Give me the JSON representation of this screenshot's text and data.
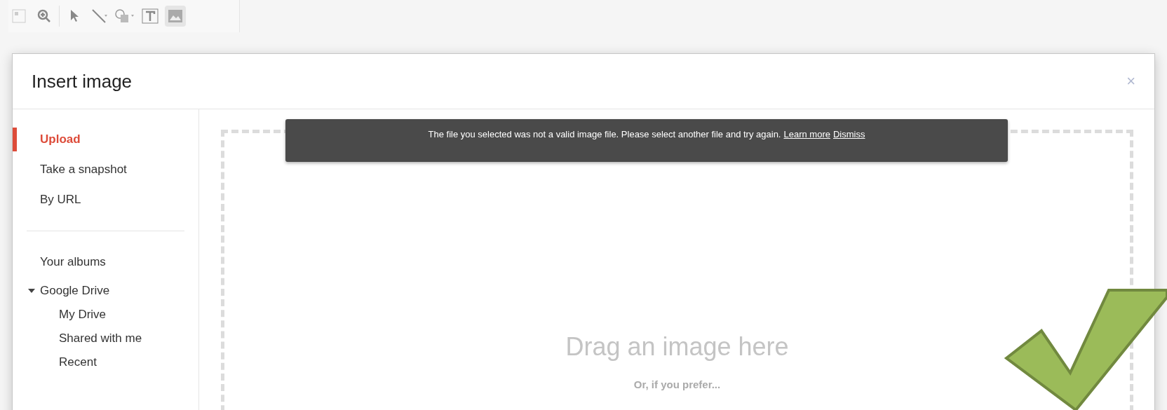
{
  "dialog": {
    "title": "Insert image",
    "close": "×"
  },
  "sidebar": {
    "sources": [
      {
        "label": "Upload",
        "selected": true
      },
      {
        "label": "Take a snapshot",
        "selected": false
      },
      {
        "label": "By URL",
        "selected": false
      }
    ],
    "locations": [
      {
        "label": "Your albums",
        "selected": false
      },
      {
        "label": "Google Drive",
        "selected": false,
        "expanded": true,
        "children": [
          {
            "label": "My Drive",
            "selected": false
          },
          {
            "label": "Shared with me",
            "selected": false
          },
          {
            "label": "Recent",
            "selected": false
          }
        ]
      }
    ]
  },
  "error_banner": {
    "message": "The file you selected was not a valid image file. Please select another file and try again.",
    "links": [
      "Learn more",
      "Dismiss"
    ]
  },
  "drop_zone": {
    "heading": "Drag an image here",
    "subheading": "Or, if you prefer..."
  }
}
